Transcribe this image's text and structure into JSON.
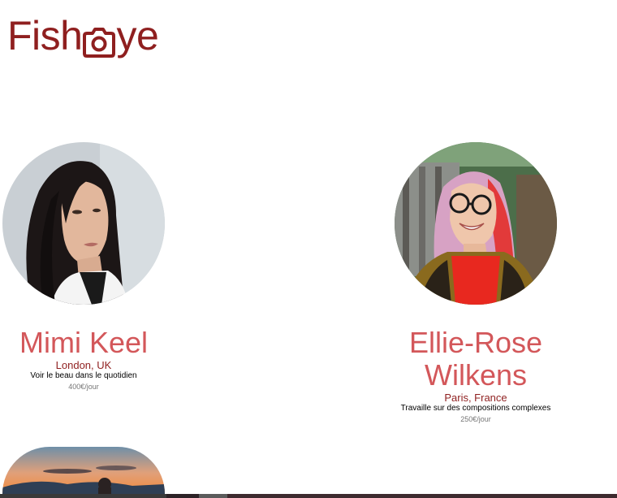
{
  "header": {
    "logo_part1": "Fish",
    "logo_part2": "ye",
    "logo_icon": "camera-icon",
    "brand_color": "#901c1c"
  },
  "photographers": [
    {
      "name": "Mimi Keel",
      "location": "London, UK",
      "tagline": "Voir le beau dans le quotidien",
      "price": "400€/jour",
      "portrait_icon": "portrait-photo"
    },
    {
      "name": "Ellie-Rose Wilkens",
      "location": "Paris, France",
      "tagline": "Travaille sur des compositions complexes",
      "price": "250€/jour",
      "portrait_icon": "portrait-photo"
    },
    {
      "portrait_icon": "sunset-photo"
    }
  ],
  "colors": {
    "name": "#d3575a",
    "location": "#901c1c",
    "price": "#757575"
  }
}
